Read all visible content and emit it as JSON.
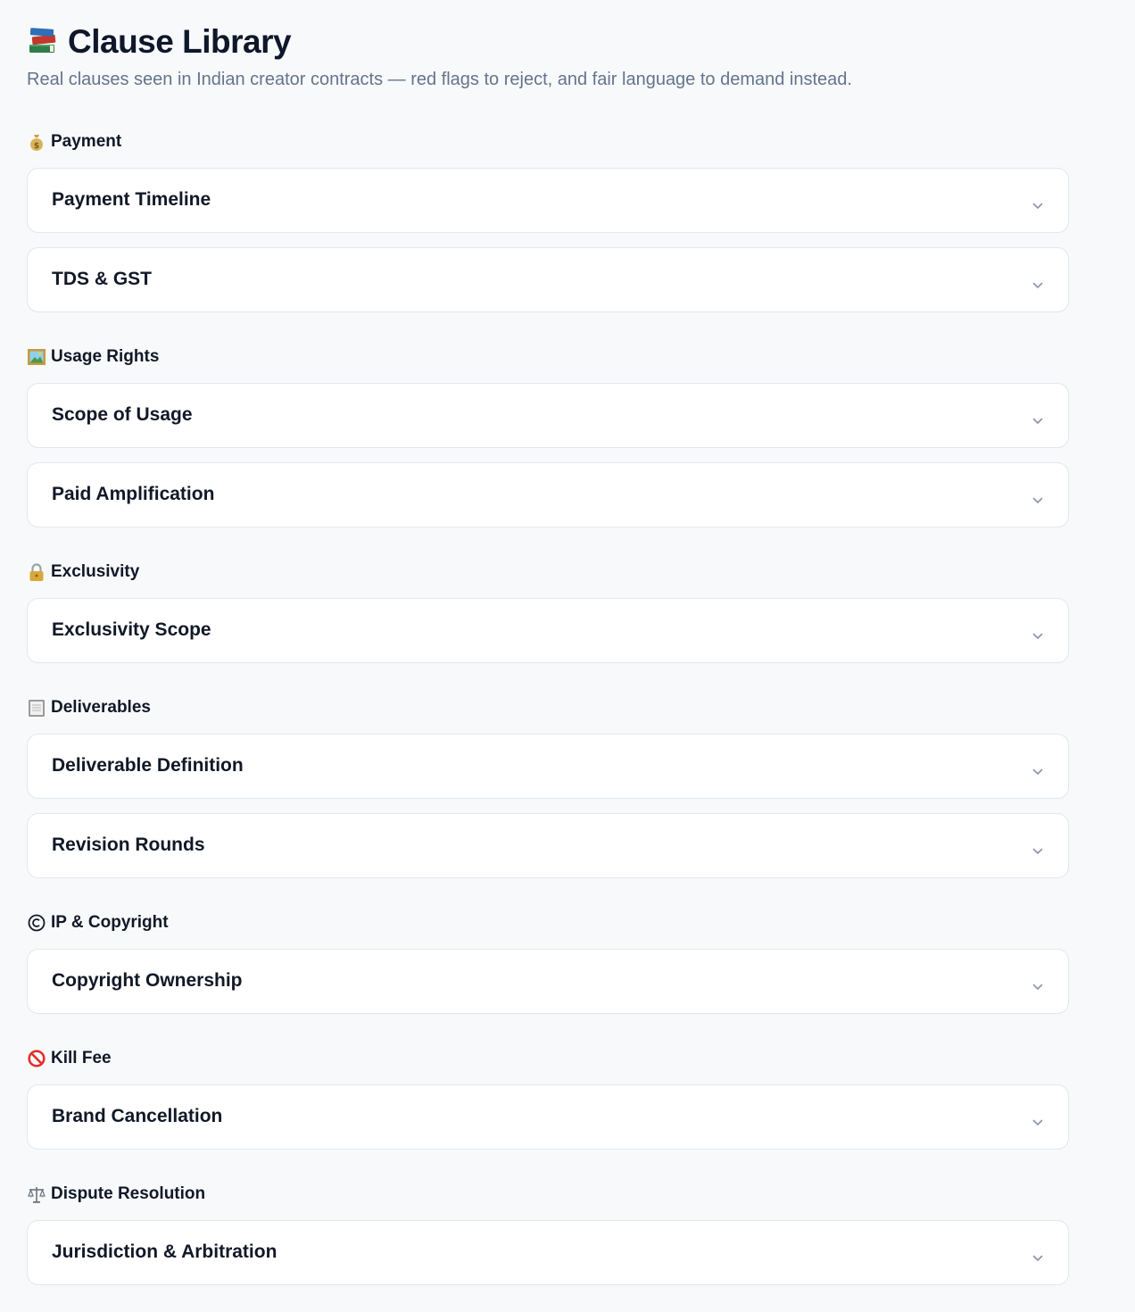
{
  "header": {
    "icon": "books-icon",
    "title": "Clause Library",
    "subtitle": "Real clauses seen in Indian creator contracts — red flags to reject, and fair language to demand instead."
  },
  "colors": {
    "background": "#f8f9fb",
    "card_border": "#e3e7ee",
    "subtitle": "#64748b",
    "chevron": "#8a94a6"
  },
  "sections": [
    {
      "icon": "money-bag-icon",
      "label": "Payment",
      "items": [
        {
          "title": "Payment Timeline"
        },
        {
          "title": "TDS & GST"
        }
      ]
    },
    {
      "icon": "framed-picture-icon",
      "label": "Usage Rights",
      "items": [
        {
          "title": "Scope of Usage"
        },
        {
          "title": "Paid Amplification"
        }
      ]
    },
    {
      "icon": "lock-icon",
      "label": "Exclusivity",
      "items": [
        {
          "title": "Exclusivity Scope"
        }
      ]
    },
    {
      "icon": "clipboard-icon",
      "label": "Deliverables",
      "items": [
        {
          "title": "Deliverable Definition"
        },
        {
          "title": "Revision Rounds"
        }
      ]
    },
    {
      "icon": "copyright-icon",
      "label": "IP & Copyright",
      "items": [
        {
          "title": "Copyright Ownership"
        }
      ]
    },
    {
      "icon": "prohibited-icon",
      "label": "Kill Fee",
      "items": [
        {
          "title": "Brand Cancellation"
        }
      ]
    },
    {
      "icon": "scales-icon",
      "label": "Dispute Resolution",
      "items": [
        {
          "title": "Jurisdiction & Arbitration"
        }
      ]
    }
  ]
}
